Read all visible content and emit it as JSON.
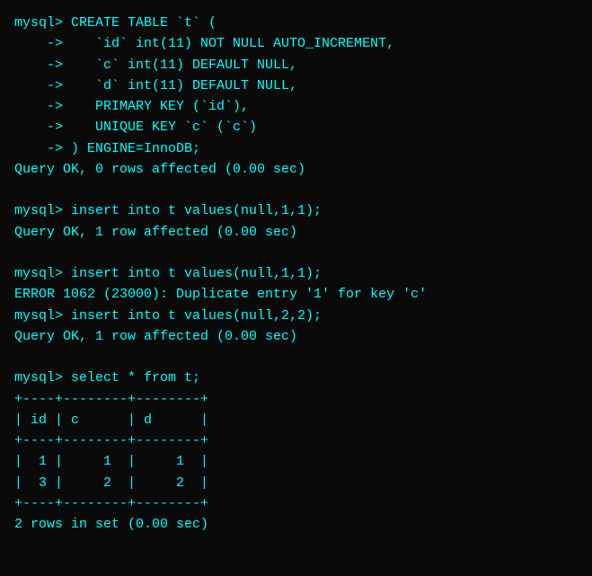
{
  "terminal": {
    "lines": [
      {
        "id": "l1",
        "text": "mysql> CREATE TABLE `t` ("
      },
      {
        "id": "l2",
        "text": "    ->    `id` int(11) NOT NULL AUTO_INCREMENT,"
      },
      {
        "id": "l3",
        "text": "    ->    `c` int(11) DEFAULT NULL,"
      },
      {
        "id": "l4",
        "text": "    ->    `d` int(11) DEFAULT NULL,"
      },
      {
        "id": "l5",
        "text": "    ->    PRIMARY KEY (`id`),"
      },
      {
        "id": "l6",
        "text": "    ->    UNIQUE KEY `c` (`c`)"
      },
      {
        "id": "l7",
        "text": "    -> ) ENGINE=InnoDB;"
      },
      {
        "id": "l8",
        "text": "Query OK, 0 rows affected (0.00 sec)"
      },
      {
        "id": "l9",
        "text": ""
      },
      {
        "id": "l10",
        "text": "mysql> insert into t values(null,1,1);"
      },
      {
        "id": "l11",
        "text": "Query OK, 1 row affected (0.00 sec)"
      },
      {
        "id": "l12",
        "text": ""
      },
      {
        "id": "l13",
        "text": "mysql> insert into t values(null,1,1);"
      },
      {
        "id": "l14",
        "text": "ERROR 1062 (23000): Duplicate entry '1' for key 'c'"
      },
      {
        "id": "l15",
        "text": "mysql> insert into t values(null,2,2);"
      },
      {
        "id": "l16",
        "text": "Query OK, 1 row affected (0.00 sec)"
      },
      {
        "id": "l17",
        "text": ""
      },
      {
        "id": "l18",
        "text": "mysql> select * from t;"
      },
      {
        "id": "l19",
        "text": "+----+--------+--------+"
      },
      {
        "id": "l20",
        "text": "| id | c      | d      |"
      },
      {
        "id": "l21",
        "text": "+----+--------+--------+"
      },
      {
        "id": "l22",
        "text": "|  1 |     1  |     1  |"
      },
      {
        "id": "l23",
        "text": "|  3 |     2  |     2  |"
      },
      {
        "id": "l24",
        "text": "+----+--------+--------+"
      },
      {
        "id": "l25",
        "text": "2 rows in set (0.00 sec)"
      }
    ]
  }
}
